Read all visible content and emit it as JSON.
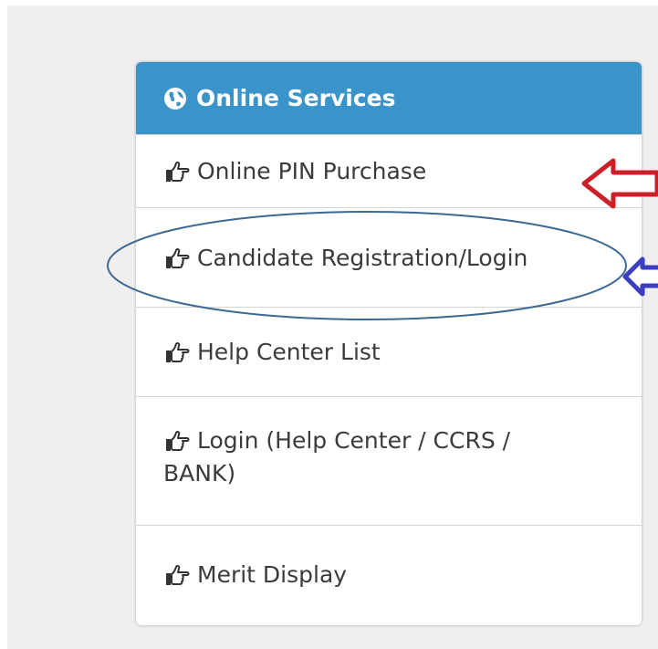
{
  "panel": {
    "title": "Online Services",
    "header_icon": "globe-icon",
    "header_color": "#3a93c9",
    "item_icon": "pointing-hand-icon",
    "items": [
      {
        "label": "Online PIN Purchase"
      },
      {
        "label": "Candidate Registration/Login"
      },
      {
        "label": "Help Center List"
      },
      {
        "label": "Login (Help Center / CCRS / BANK)",
        "label_line1": "Login (Help Center / CCRS /",
        "label_line2": "BANK)"
      },
      {
        "label": "Merit Display"
      }
    ]
  },
  "annotations": {
    "red_arrow_color": "#cc1f26",
    "blue_arrow_color": "#3b3fbf",
    "ellipse_color": "#3c6894"
  }
}
